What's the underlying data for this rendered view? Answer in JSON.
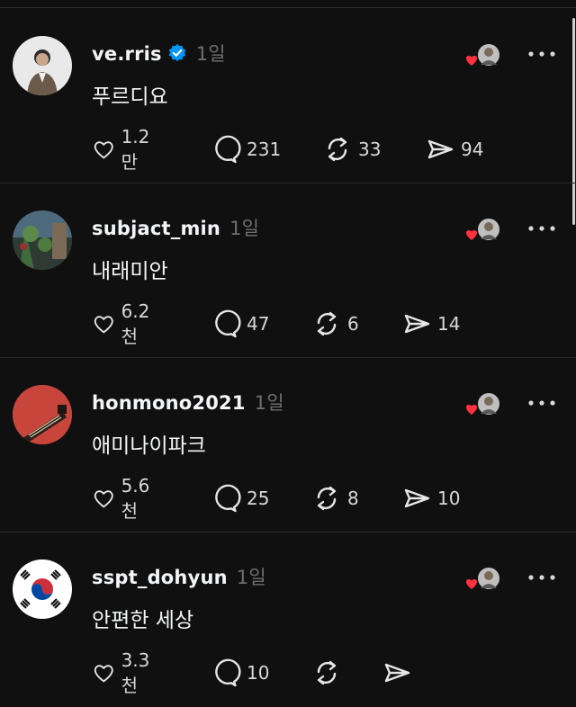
{
  "posts": [
    {
      "username": "ve.rris",
      "verified": true,
      "time": "1일",
      "text": "푸르디요",
      "likes": "1.2만",
      "replies": "231",
      "reposts": "33",
      "shares": "94",
      "avatar": "person-photo"
    },
    {
      "username": "subjact_min",
      "verified": false,
      "time": "1일",
      "text": "내래미안",
      "likes": "6.2천",
      "replies": "47",
      "reposts": "6",
      "shares": "14",
      "avatar": "garden-photo"
    },
    {
      "username": "honmono2021",
      "verified": false,
      "time": "1일",
      "text": "애미나이파크",
      "likes": "5.6천",
      "replies": "25",
      "reposts": "8",
      "shares": "10",
      "avatar": "guitar-photo"
    },
    {
      "username": "sspt_dohyun",
      "verified": false,
      "time": "1일",
      "text": "안편한 세상",
      "likes": "3.3천",
      "replies": "10",
      "reposts": "",
      "shares": "",
      "avatar": "korean-flag"
    }
  ],
  "colors": {
    "background": "#101010",
    "verified": "#0095f6",
    "heart": "#ff3040",
    "muted": "#6f6f6f"
  }
}
